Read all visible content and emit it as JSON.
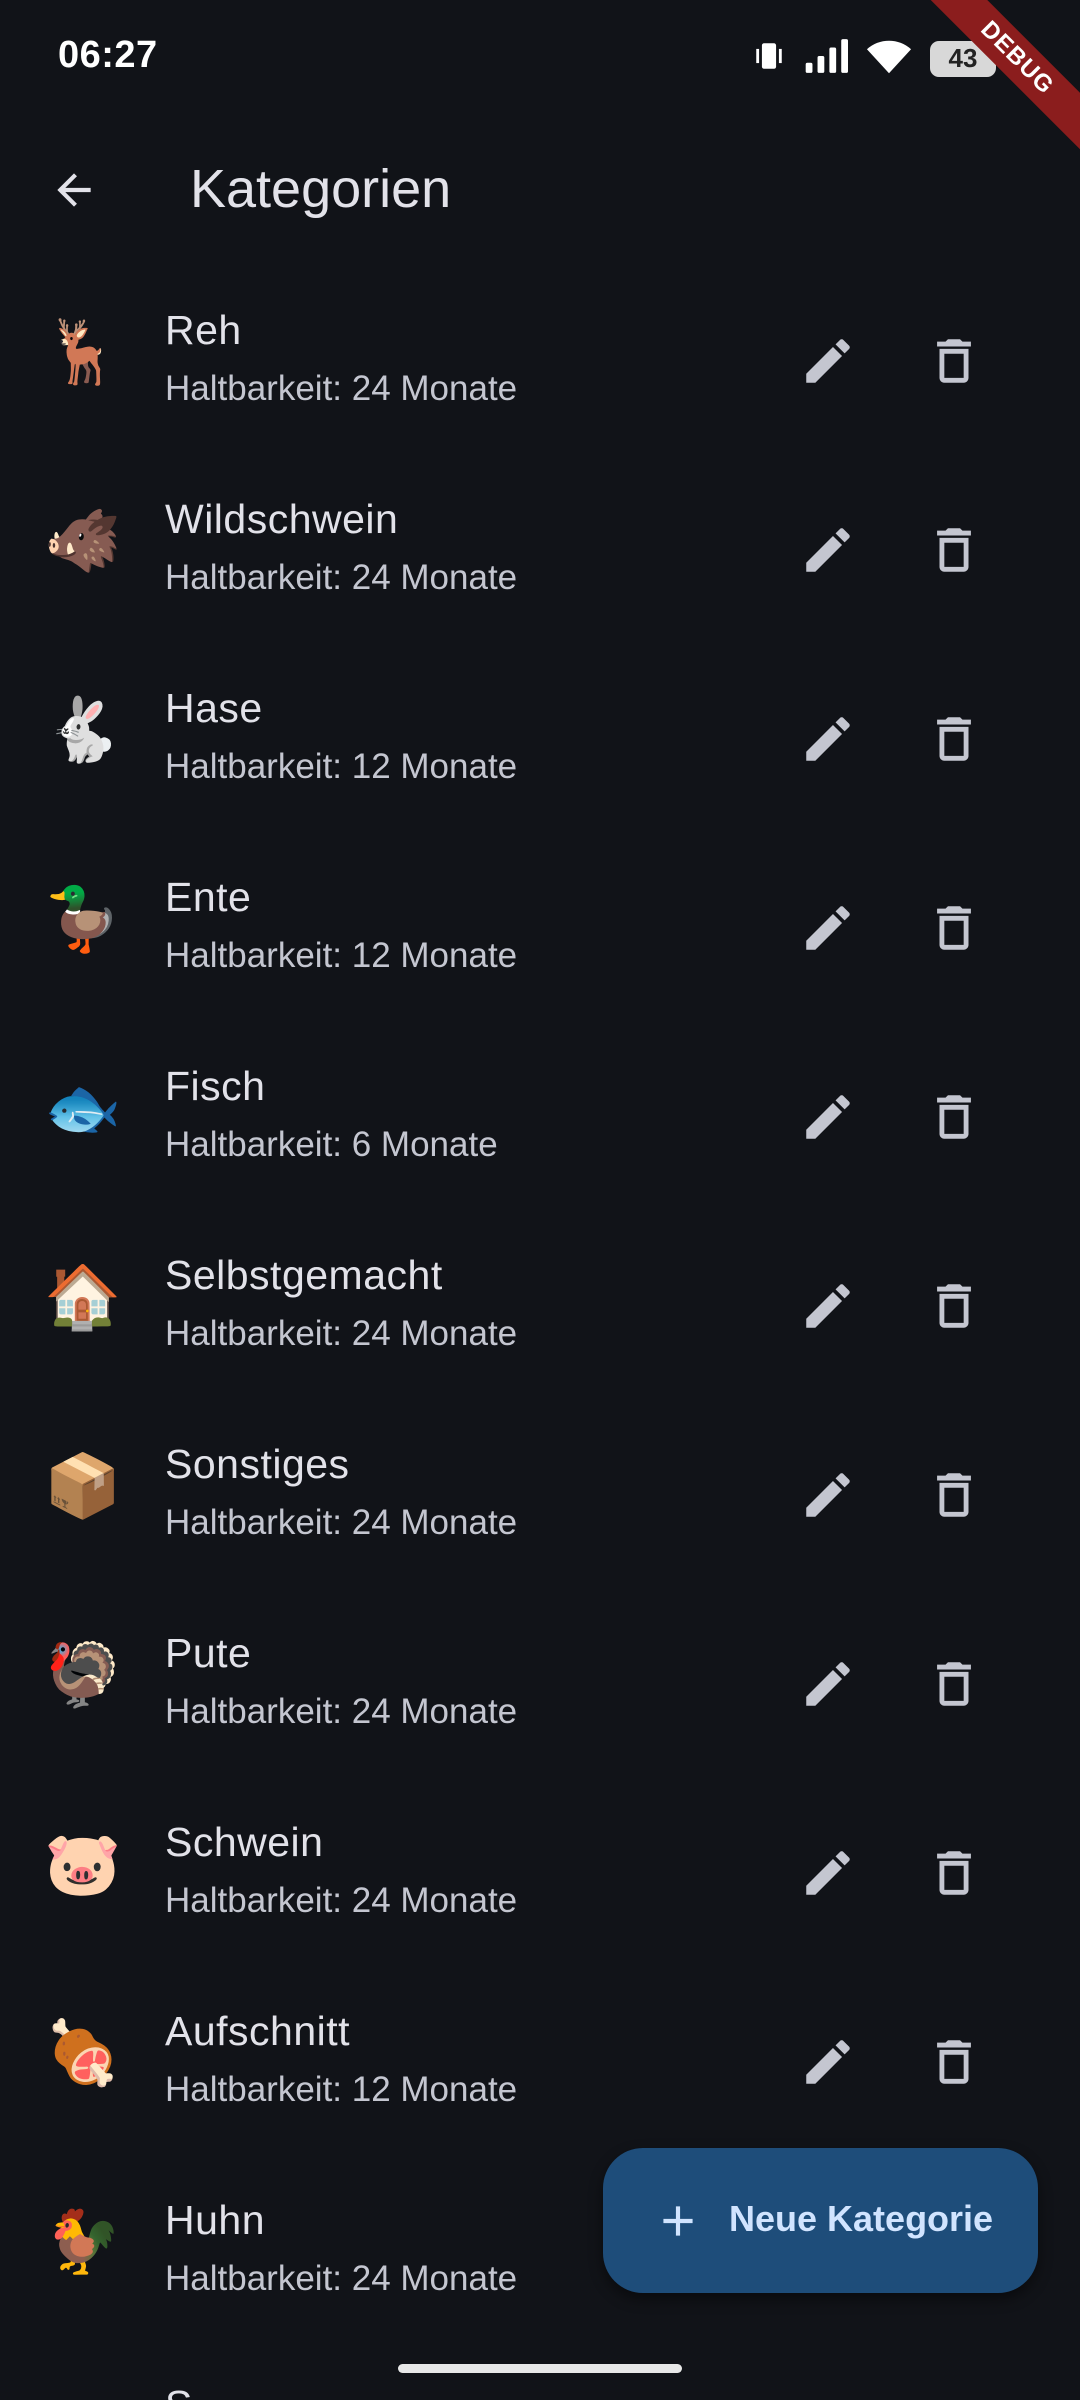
{
  "status_bar": {
    "time": "06:27",
    "battery": "43",
    "icons": [
      "vibrate-icon",
      "signal-icon",
      "wifi-icon",
      "battery-icon"
    ],
    "debug_banner": "DEBUG"
  },
  "app_bar": {
    "back_icon": "arrow-back-icon",
    "title": "Kategorien"
  },
  "categories": [
    {
      "emoji": "🦌",
      "name": "Reh",
      "subtitle": "Haltbarkeit: 24 Monate"
    },
    {
      "emoji": "🐗",
      "name": "Wildschwein",
      "subtitle": "Haltbarkeit: 24 Monate"
    },
    {
      "emoji": "🐇",
      "name": "Hase",
      "subtitle": "Haltbarkeit: 12 Monate"
    },
    {
      "emoji": "🦆",
      "name": "Ente",
      "subtitle": "Haltbarkeit: 12 Monate"
    },
    {
      "emoji": "🐟",
      "name": "Fisch",
      "subtitle": "Haltbarkeit: 6 Monate"
    },
    {
      "emoji": "🏠",
      "name": "Selbstgemacht",
      "subtitle": "Haltbarkeit: 24 Monate"
    },
    {
      "emoji": "📦",
      "name": "Sonstiges",
      "subtitle": "Haltbarkeit: 24 Monate"
    },
    {
      "emoji": "🦃",
      "name": "Pute",
      "subtitle": "Haltbarkeit: 24 Monate"
    },
    {
      "emoji": "🐷",
      "name": "Schwein",
      "subtitle": "Haltbarkeit: 24 Monate"
    },
    {
      "emoji": "🍖",
      "name": "Aufschnitt",
      "subtitle": "Haltbarkeit: 12 Monate"
    },
    {
      "emoji": "🐓",
      "name": "Huhn",
      "subtitle": "Haltbarkeit: 24 Monate"
    }
  ],
  "row_actions": {
    "edit_icon": "pencil-icon",
    "delete_icon": "trash-icon"
  },
  "fab": {
    "icon": "plus-icon",
    "label": "Neue Kategorie"
  },
  "colors": {
    "background": "#111318",
    "text_primary": "#e2e2e9",
    "text_secondary": "#c4c6d0",
    "icon": "#c4c6d0",
    "fab_background": "#1e4d7a",
    "fab_foreground": "#d1e4ff",
    "debug_ribbon": "#8b1d1d"
  }
}
